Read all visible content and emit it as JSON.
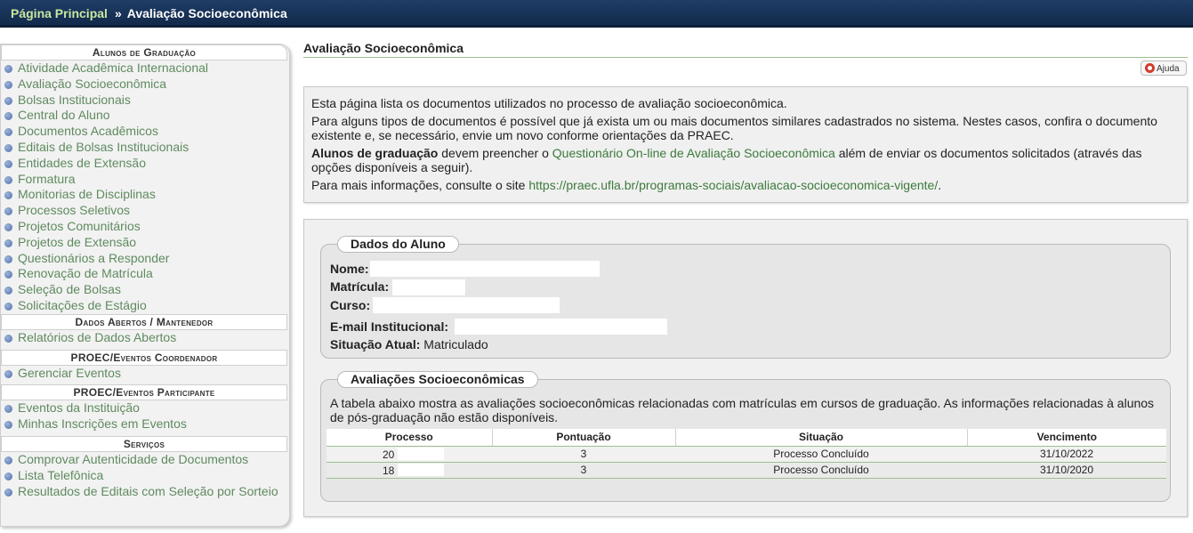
{
  "breadcrumb": {
    "home": "Página Principal",
    "separator": "»",
    "current": "Avaliação Socioeconômica"
  },
  "sidebar": {
    "groups": [
      {
        "title": "Alunos de Graduação",
        "items": [
          "Atividade Acadêmica Internacional",
          "Avaliação Socioeconômica",
          "Bolsas Institucionais",
          "Central do Aluno",
          "Documentos Acadêmicos",
          "Editais de Bolsas Institucionais",
          "Entidades de Extensão",
          "Formatura",
          "Monitorias de Disciplinas",
          "Processos Seletivos",
          "Projetos Comunitários",
          "Projetos de Extensão",
          "Questionários a Responder",
          "Renovação de Matrícula",
          "Seleção de Bolsas",
          "Solicitações de Estágio"
        ]
      },
      {
        "title": "Dados Abertos / Mantenedor",
        "items": [
          "Relatórios de Dados Abertos"
        ]
      },
      {
        "title": "PROEC/Eventos Coordenador",
        "items": [
          "Gerenciar Eventos"
        ]
      },
      {
        "title": "PROEC/Eventos Participante",
        "items": [
          "Eventos da Instituição",
          "Minhas Inscrições em Eventos"
        ]
      },
      {
        "title": "Serviços",
        "items": [
          "Comprovar Autenticidade de Documentos",
          "Lista Telefônica",
          "Resultados de Editais com Seleção por Sorteio"
        ]
      }
    ]
  },
  "page": {
    "title": "Avaliação Socioeconômica",
    "help_label": "Ajuda"
  },
  "info": {
    "p1": "Esta página lista os documentos utilizados no processo de avaliação socioeconômica.",
    "p2": "Para alguns tipos de documentos é possível que já exista um ou mais documentos similares cadastrados no sistema. Nestes casos, confira o documento existente e, se necessário, envie um novo conforme orientações da PRAEC.",
    "p3_bold": "Alunos de graduação",
    "p3_a": " devem preencher o ",
    "p3_link": "Questionário On-line de Avaliação Socioeconômica",
    "p3_b": " além de enviar os documentos solicitados (através das opções disponíveis a seguir).",
    "p4_a": "Para mais informações, consulte o site ",
    "p4_link": "https://praec.ufla.br/programas-sociais/avaliacao-socioeconomica-vigente/",
    "p4_b": "."
  },
  "student": {
    "legend": "Dados do Aluno",
    "name_label": "Nome:",
    "matricula_label": "Matrícula:",
    "curso_label": "Curso:",
    "email_label": "E-mail Institucional:",
    "situacao_label": "Situação Atual:",
    "situacao_value": "Matriculado"
  },
  "evaluations": {
    "legend": "Avaliações Socioeconômicas",
    "description": "A tabela abaixo mostra as avaliações socioeconômicas relacionadas com matrículas em cursos de graduação. As informações relacionadas à alunos de pós-graduação não estão disponíveis.",
    "columns": [
      "Processo",
      "Pontuação",
      "Situação",
      "Vencimento"
    ],
    "rows": [
      {
        "processo": "20",
        "pontuacao": "3",
        "situacao": "Processo Concluído",
        "vencimento": "31/10/2022"
      },
      {
        "processo": "18",
        "pontuacao": "3",
        "situacao": "Processo Concluído",
        "vencimento": "31/10/2020"
      }
    ]
  },
  "colors": {
    "topbar": "#1f3d66",
    "link_green": "#3c7a3c",
    "sidebar_link": "#5f8a5f",
    "divider_green": "#9cc08c"
  }
}
